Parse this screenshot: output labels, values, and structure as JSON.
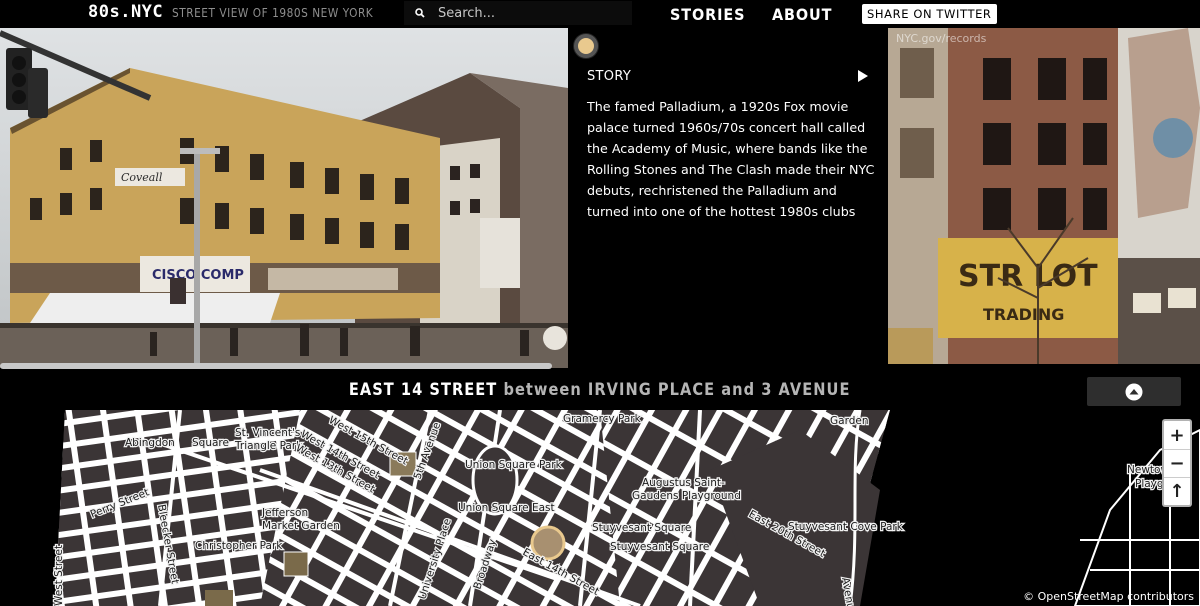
{
  "header": {
    "logo": "80s.NYC",
    "tagline": "STREET VIEW OF 1980S NEW YORK",
    "search_placeholder": "Search...",
    "nav": {
      "stories": "STORIES",
      "about": "ABOUT"
    },
    "share_label": "SHARE ON TWITTER"
  },
  "story": {
    "heading": "STORY",
    "text": "The famed Palladium, a 1920s Fox movie palace turned 1960s/70s concert hall called the Academy of Music, where bands like the Rolling Stones and The Clash made their NYC debuts, rechristened the Palladium and turned into one of the hottest 1980s clubs"
  },
  "street": {
    "name": "EAST 14 STREET",
    "between": "between",
    "cross_a": "IRVING PLACE",
    "and": "and",
    "cross_b": "3 AVENUE"
  },
  "photos": {
    "left_signs": {
      "sign1": "CISCO COMP",
      "sign2": "Coveall"
    },
    "right_signs": {
      "sign1": "STR LOT",
      "sign2": "TRADING",
      "watermark": "NYC.gov/records"
    }
  },
  "map": {
    "labels": {
      "abingdon": "Abingdon",
      "sq": "Square",
      "st_vincents": "St. Vincent's",
      "triangle_park": "Triangle Park",
      "w15": "West 15th Street",
      "w14": "West 14th Street",
      "w13": "West 13th Street",
      "fifth_ave": "5th Avenue",
      "union_sq_park": "Union Square Park",
      "union_sq_east": "Union Square East",
      "gramercy": "Gramercy Park",
      "garden": "Garden",
      "augustus": "Augustus Saint-",
      "gaudens": "Gaudens Playground",
      "stuyvesant_sq": "Stuyvesant Square",
      "stuyvesant_sq2": "Stuyvesant Square",
      "e20": "East 20th Street",
      "stuyvesant_cove": "Stuyvesant Cove Park",
      "newtown": "Newtown",
      "playground": "Playgr",
      "perry": "Perry Street",
      "bleecker": "Bleecker Street",
      "jefferson": "Jefferson",
      "market_garden": "Market Garden",
      "christopher": "Christopher Park",
      "west_street": "West Street",
      "university": "University Place",
      "broadway": "Broadway",
      "e14": "East 14th Street",
      "avenue_c": "Avenue"
    },
    "zoom_in": "+",
    "zoom_out": "−",
    "north_arrow": "↑",
    "attribution": "© OpenStreetMap contributors"
  },
  "colors": {
    "accent_dot": "#e9c98e",
    "map_block": "#3b3536",
    "map_street": "#ffffff"
  }
}
